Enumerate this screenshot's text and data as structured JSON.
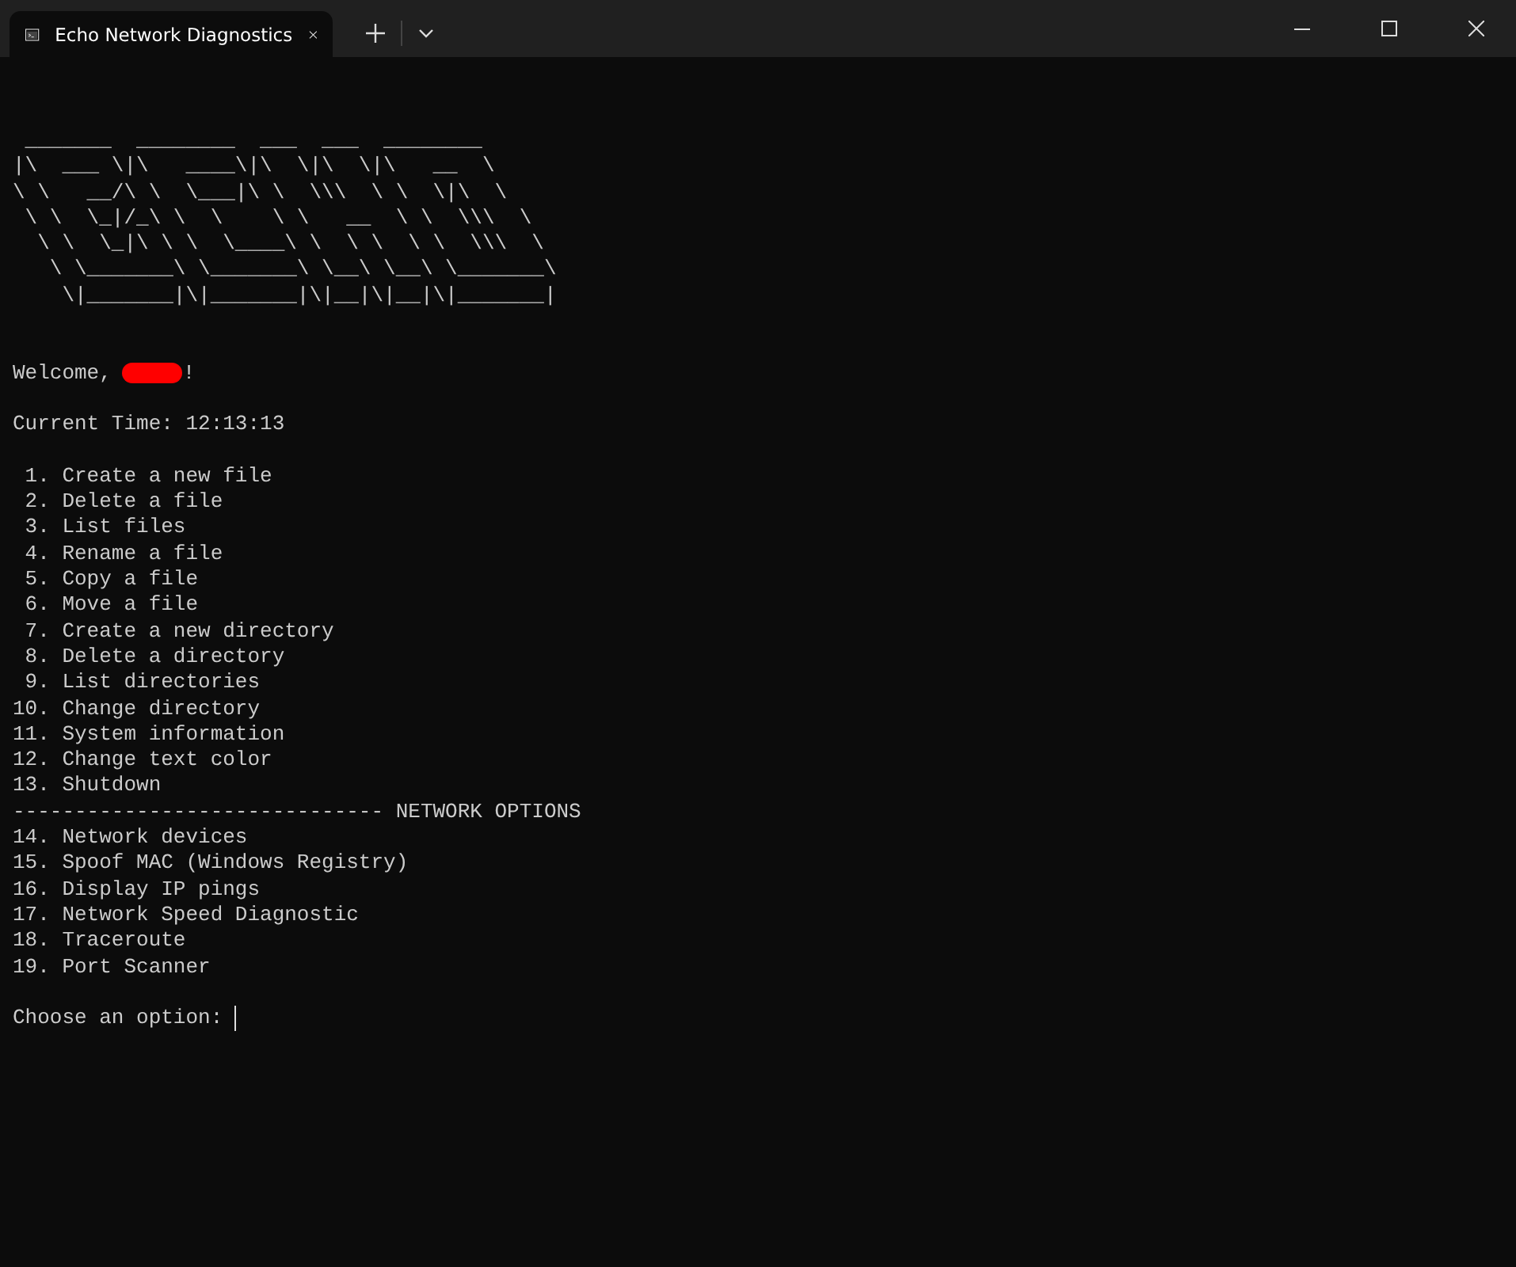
{
  "window": {
    "tab_title": "Echo Network Diagnostics"
  },
  "terminal": {
    "banner": [
      " _______  ________  ___  ___  ________",
      "|\\  ___ \\|\\   ____\\|\\  \\|\\  \\|\\   __  \\",
      "\\ \\   __/\\ \\  \\___|\\ \\  \\\\\\  \\ \\  \\|\\  \\",
      " \\ \\  \\_|/_\\ \\  \\    \\ \\   __  \\ \\  \\\\\\  \\",
      "  \\ \\  \\_|\\ \\ \\  \\____\\ \\  \\ \\  \\ \\  \\\\\\  \\",
      "   \\ \\_______\\ \\_______\\ \\__\\ \\__\\ \\_______\\",
      "    \\|_______|\\|_______|\\|__|\\|__|\\|_______|"
    ],
    "welcome": {
      "prefix": "Welcome,",
      "suffix": "!"
    },
    "current_time": "Current Time: 12:13:13",
    "menu": [
      " 1. Create a new file",
      " 2. Delete a file",
      " 3. List files",
      " 4. Rename a file",
      " 5. Copy a file",
      " 6. Move a file",
      " 7. Create a new directory",
      " 8. Delete a directory",
      " 9. List directories",
      "10. Change directory",
      "11. System information",
      "12. Change text color",
      "13. Shutdown",
      "------------------------------ NETWORK OPTIONS",
      "14. Network devices",
      "15. Spoof MAC (Windows Registry)",
      "16. Display IP pings",
      "17. Network Speed Diagnostic",
      "18. Traceroute",
      "19. Port Scanner"
    ],
    "prompt": "Choose an option: "
  }
}
